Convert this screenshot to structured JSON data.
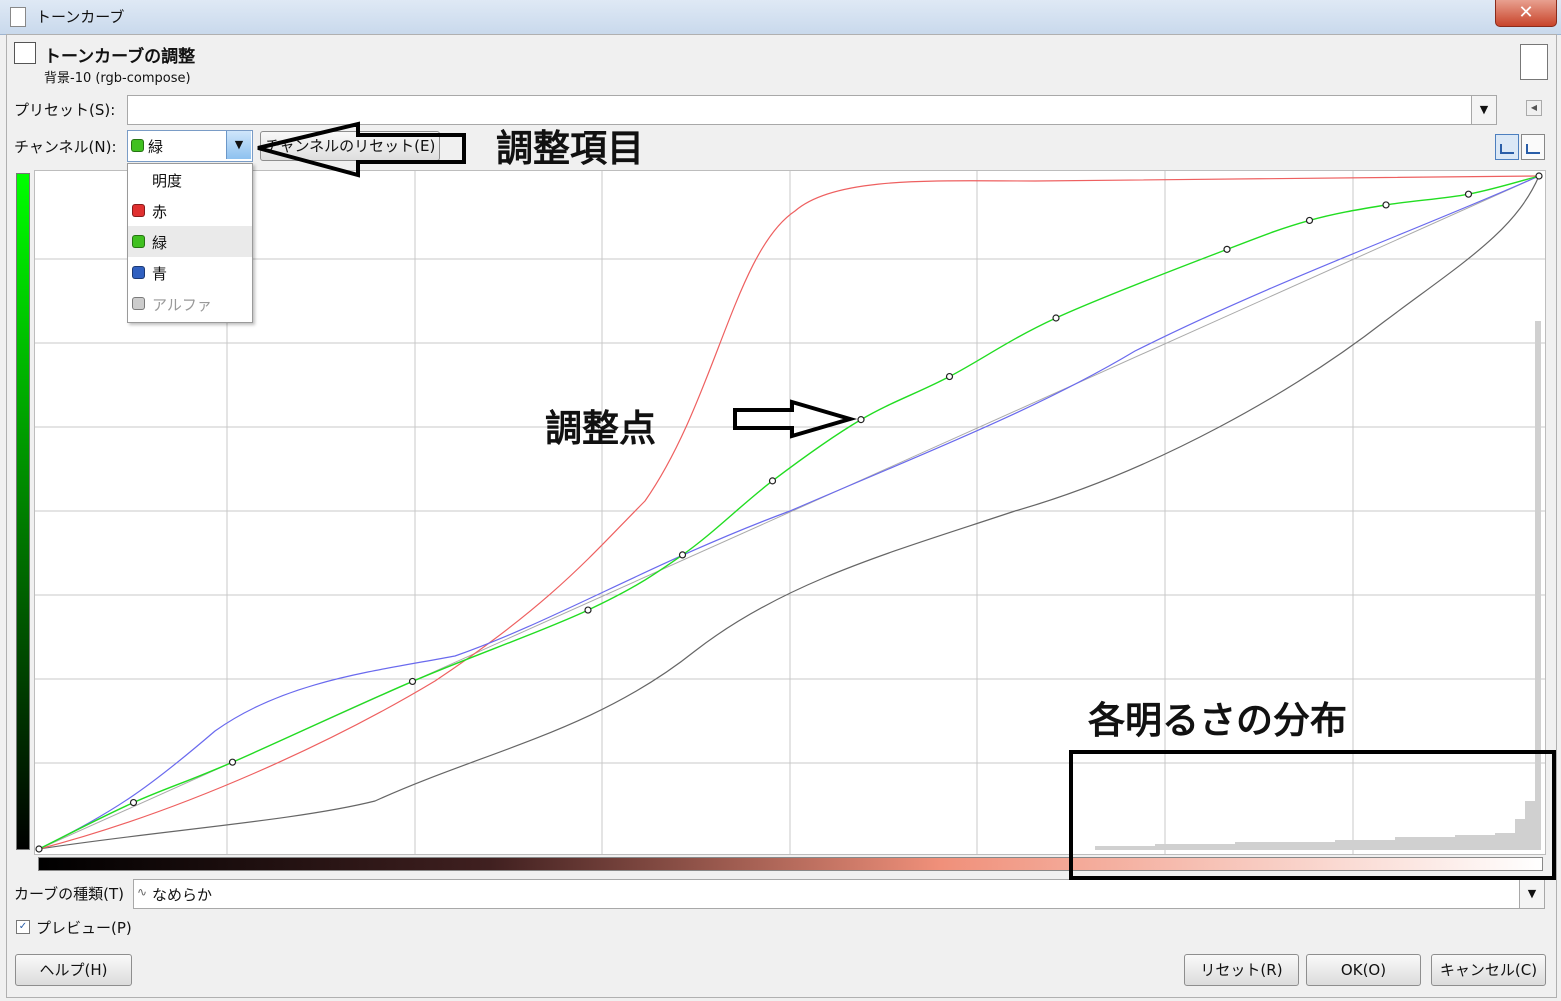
{
  "window": {
    "title": "トーンカーブ",
    "close_symbol": "✕"
  },
  "header": {
    "title": "トーンカーブの調整",
    "subtitle": "背景-10 (rgb-compose)"
  },
  "preset": {
    "label": "プリセット(S):",
    "value": ""
  },
  "channel": {
    "label": "チャンネル(N):",
    "selected": "緑",
    "reset_label": "チャンネルのリセット(E)",
    "options": [
      {
        "label": "明度",
        "color": ""
      },
      {
        "label": "赤",
        "color": "#e03030"
      },
      {
        "label": "緑",
        "color": "#40c020"
      },
      {
        "label": "青",
        "color": "#3060c0"
      },
      {
        "label": "アルファ",
        "color": "#999999",
        "disabled": true
      }
    ]
  },
  "curve_type": {
    "label": "カーブの種類(T)",
    "value": "なめらか"
  },
  "preview": {
    "label": "プレビュー(P)",
    "checked": true
  },
  "buttons": {
    "help": "ヘルプ(H)",
    "reset": "リセット(R)",
    "ok": "OK(O)",
    "cancel": "キャンセル(C)"
  },
  "annotations": {
    "items_label": "調整項目",
    "points_label": "調整点",
    "distribution_label": "各明るさの分布"
  },
  "colors": {
    "green_curve": "#22dd22",
    "red_curve": "#ee6060",
    "blue_curve": "#6a6aee",
    "value_curve": "#666666"
  },
  "curve_points_green": [
    [
      0,
      0
    ],
    [
      0.063,
      0.069
    ],
    [
      0.129,
      0.129
    ],
    [
      0.249,
      0.249
    ],
    [
      0.366,
      0.355
    ],
    [
      0.429,
      0.437
    ],
    [
      0.489,
      0.547
    ],
    [
      0.548,
      0.638
    ],
    [
      0.607,
      0.702
    ],
    [
      0.678,
      0.789
    ],
    [
      0.792,
      0.891
    ],
    [
      0.847,
      0.934
    ],
    [
      0.898,
      0.957
    ],
    [
      0.953,
      0.973
    ],
    [
      1,
      1
    ]
  ]
}
